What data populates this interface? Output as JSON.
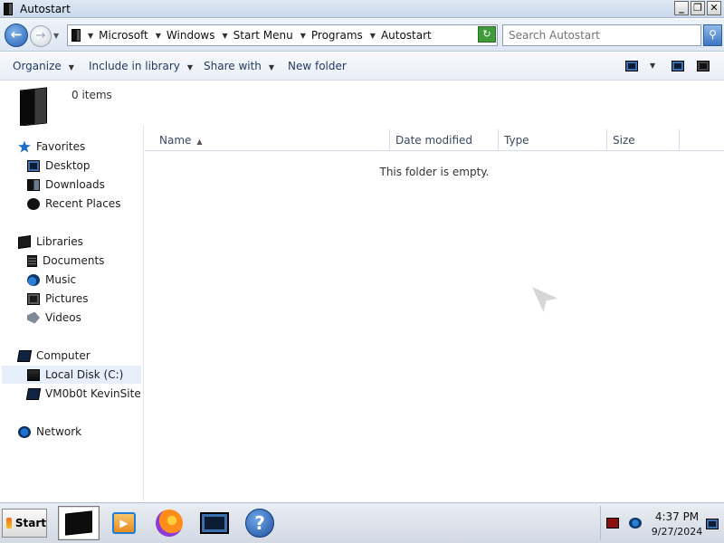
{
  "window": {
    "title": "Autostart",
    "controls": {
      "minimize": "_",
      "maximize": "❐",
      "close": "✕"
    }
  },
  "nav": {
    "back_icon": "back-arrow-icon",
    "forward_icon": "forward-arrow-icon",
    "breadcrumb": [
      "Microsoft",
      "Windows",
      "Start Menu",
      "Programs",
      "Autostart"
    ],
    "search_placeholder": "Search Autostart"
  },
  "toolbar": {
    "organize": "Organize",
    "include_in_library": "Include in library",
    "share_with": "Share with",
    "new_folder": "New folder"
  },
  "details": {
    "item_count": "0 items"
  },
  "sidebar": {
    "groups": [
      {
        "label": "Favorites",
        "icon": "star-icon",
        "items": [
          {
            "label": "Desktop",
            "icon": "desktop-icon"
          },
          {
            "label": "Downloads",
            "icon": "downloads-icon"
          },
          {
            "label": "Recent Places",
            "icon": "recent-places-icon"
          }
        ]
      },
      {
        "label": "Libraries",
        "icon": "libraries-icon",
        "items": [
          {
            "label": "Documents",
            "icon": "documents-icon"
          },
          {
            "label": "Music",
            "icon": "music-icon"
          },
          {
            "label": "Pictures",
            "icon": "pictures-icon"
          },
          {
            "label": "Videos",
            "icon": "videos-icon"
          }
        ]
      },
      {
        "label": "Computer",
        "icon": "computer-icon",
        "items": [
          {
            "label": "Local Disk (C:)",
            "icon": "disk-icon",
            "selected": true
          },
          {
            "label": "VM0b0t KevinSite",
            "icon": "network-drive-icon"
          }
        ]
      },
      {
        "label": "Network",
        "icon": "network-icon",
        "items": []
      }
    ]
  },
  "columns": {
    "name": "Name",
    "date_modified": "Date modified",
    "type": "Type",
    "size": "Size"
  },
  "content": {
    "empty_message": "This folder is empty."
  },
  "taskbar": {
    "start_label": "Start",
    "apps": [
      "file-explorer-icon",
      "media-player-icon",
      "firefox-icon",
      "screen-icon",
      "help-icon"
    ],
    "help_glyph": "?",
    "clock_time": "4:37 PM",
    "clock_date": "9/27/2024"
  },
  "colors": {
    "accent": "#2a62b5",
    "selection": "#e5eef9",
    "titlebar": "#c9d8ec"
  }
}
